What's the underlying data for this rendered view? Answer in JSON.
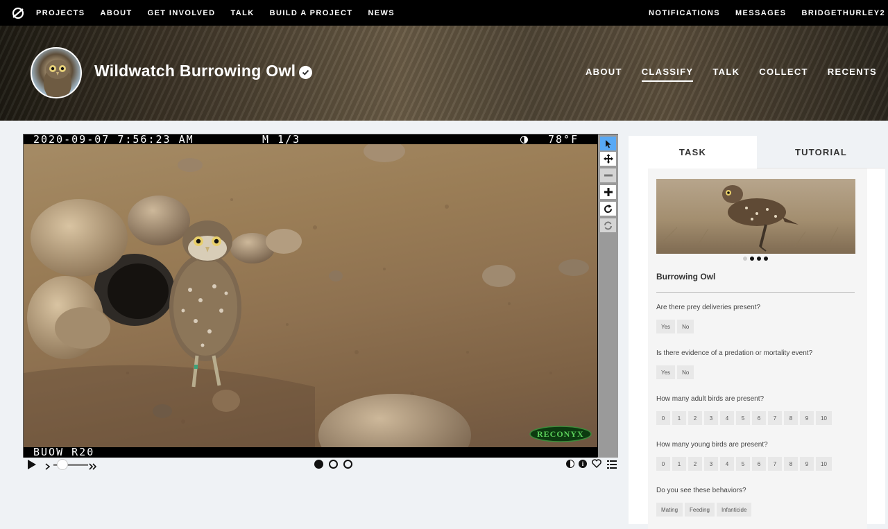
{
  "topnav": {
    "left": [
      "PROJECTS",
      "ABOUT",
      "GET INVOLVED",
      "TALK",
      "BUILD A PROJECT",
      "NEWS"
    ],
    "right": [
      "NOTIFICATIONS",
      "MESSAGES",
      "BRIDGETHURLEY2"
    ]
  },
  "project": {
    "title": "Wildwatch Burrowing Owl",
    "nav": [
      "ABOUT",
      "CLASSIFY",
      "TALK",
      "COLLECT",
      "RECENTS"
    ],
    "active_nav": "CLASSIFY"
  },
  "subject": {
    "top_left": "2020-09-07 7:56:23 AM",
    "frame": "M 1/3",
    "temp": "78°F",
    "camera": "BUOW R20",
    "brand": "RECONYX"
  },
  "tabs": [
    "TASK",
    "TUTORIAL"
  ],
  "task": {
    "species": "Burrowing Owl",
    "questions": [
      {
        "label": "Are there prey deliveries present?",
        "options": [
          "Yes",
          "No"
        ]
      },
      {
        "label": "Is there evidence of a predation or mortality event?",
        "options": [
          "Yes",
          "No"
        ]
      },
      {
        "label": "How many adult birds are present?",
        "options": [
          "0",
          "1",
          "2",
          "3",
          "4",
          "5",
          "6",
          "7",
          "8",
          "9",
          "10"
        ]
      },
      {
        "label": "How many young birds are present?",
        "options": [
          "0",
          "1",
          "2",
          "3",
          "4",
          "5",
          "6",
          "7",
          "8",
          "9",
          "10"
        ]
      },
      {
        "label": "Do you see these behaviors?",
        "options": [
          "Mating",
          "Feeding",
          "Infanticide"
        ]
      }
    ]
  },
  "colors": {
    "accent": "#65c9d8",
    "tool_active": "#58a9f5"
  }
}
